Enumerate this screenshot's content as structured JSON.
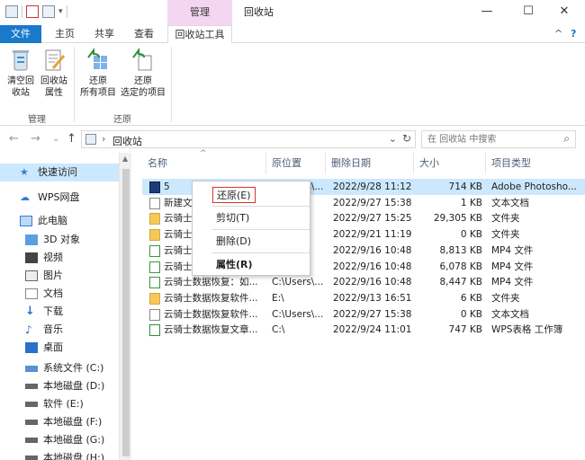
{
  "window": {
    "title": "回收站",
    "context_tab_header": "管理",
    "minimize": "—",
    "maximize": "☐",
    "close": "✕"
  },
  "tabs": {
    "file": "文件",
    "home": "主页",
    "share": "共享",
    "view": "查看",
    "recycle_tools": "回收站工具",
    "collapse": "^",
    "help": "?"
  },
  "ribbon": {
    "empty_recycle_bin": [
      "清空回",
      "收站"
    ],
    "recycle_bin_properties": [
      "回收站",
      "属性"
    ],
    "restore_all": [
      "还原",
      "所有项目"
    ],
    "restore_selected": [
      "还原",
      "选定的项目"
    ],
    "group_manage": "管理",
    "group_restore": "还原"
  },
  "address": {
    "back": "←",
    "forward": "→",
    "recent": "⌄",
    "up": "↑",
    "crumb_sep": "›",
    "path": "回收站",
    "dropdown": "⌄",
    "refresh": "↻",
    "search_placeholder": "在 回收站 中搜索",
    "search_icon": "⌕"
  },
  "nav": [
    {
      "label": "快速访问",
      "icon": "star-icon"
    },
    {
      "label": "WPS网盘",
      "icon": "cloud-icon"
    },
    {
      "label": "此电脑",
      "icon": "computer-icon"
    },
    {
      "label": "3D 对象",
      "icon": "3d-objects-icon"
    },
    {
      "label": "视频",
      "icon": "video-icon"
    },
    {
      "label": "图片",
      "icon": "pictures-icon"
    },
    {
      "label": "文档",
      "icon": "documents-icon"
    },
    {
      "label": "下载",
      "icon": "download-icon"
    },
    {
      "label": "音乐",
      "icon": "music-icon"
    },
    {
      "label": "桌面",
      "icon": "desktop-icon"
    },
    {
      "label": "系统文件 (C:)",
      "icon": "system-drive-icon"
    },
    {
      "label": "本地磁盘 (D:)",
      "icon": "drive-icon"
    },
    {
      "label": "软件 (E:)",
      "icon": "drive-icon"
    },
    {
      "label": "本地磁盘 (F:)",
      "icon": "drive-icon"
    },
    {
      "label": "本地磁盘 (G:)",
      "icon": "drive-icon"
    },
    {
      "label": "本地磁盘 (H:)",
      "icon": "drive-icon"
    }
  ],
  "columns": {
    "sort_indicator": "^",
    "name": "名称",
    "original_location": "原位置",
    "date_deleted": "删除日期",
    "size": "大小",
    "item_type": "项目类型"
  },
  "files": [
    {
      "name": "5",
      "loc": "C:\\Users\\...",
      "date": "2022/9/28 11:12",
      "size": "714 KB",
      "type": "Adobe Photosho...",
      "icon": "psd-file-icon"
    },
    {
      "name": "新建文...",
      "loc": "",
      "date": "2022/9/27 15:38",
      "size": "1 KB",
      "type": "文本文档",
      "icon": "text-file-icon"
    },
    {
      "name": "云骑士...",
      "loc": "",
      "date": "2022/9/27 15:25",
      "size": "29,305 KB",
      "type": "文件夹",
      "icon": "folder-icon"
    },
    {
      "name": "云骑士...",
      "loc": "",
      "date": "2022/9/21 11:19",
      "size": "0 KB",
      "type": "文件夹",
      "icon": "folder-icon"
    },
    {
      "name": "云骑士...",
      "loc": "",
      "date": "2022/9/16 10:48",
      "size": "8,813 KB",
      "type": "MP4 文件",
      "icon": "video-file-icon"
    },
    {
      "name": "云骑士...",
      "loc": "",
      "date": "2022/9/16 10:48",
      "size": "6,078 KB",
      "type": "MP4 文件",
      "icon": "video-file-icon"
    },
    {
      "name": "云骑士数据恢复：如...",
      "loc": "C:\\Users\\...",
      "date": "2022/9/16 10:48",
      "size": "8,447 KB",
      "type": "MP4 文件",
      "icon": "video-file-icon"
    },
    {
      "name": "云骑士数据恢复软件...",
      "loc": "E:\\",
      "date": "2022/9/13 16:51",
      "size": "6 KB",
      "type": "文件夹",
      "icon": "folder-icon"
    },
    {
      "name": "云骑士数据恢复软件...",
      "loc": "C:\\Users\\...",
      "date": "2022/9/27 15:38",
      "size": "0 KB",
      "type": "文本文档",
      "icon": "text-file-icon"
    },
    {
      "name": "云骑士数据恢复文章...",
      "loc": "C:\\",
      "date": "2022/9/24 11:01",
      "size": "747 KB",
      "type": "WPS表格 工作簿",
      "icon": "spreadsheet-file-icon"
    }
  ],
  "context_menu": {
    "restore": "还原(E)",
    "cut": "剪切(T)",
    "delete": "删除(D)",
    "properties": "属性(R)"
  },
  "colors": {
    "file_tab": "#1979ca",
    "context_header": "#f5d6f2",
    "selection": "#cce8ff",
    "highlight_border": "#e03030"
  }
}
